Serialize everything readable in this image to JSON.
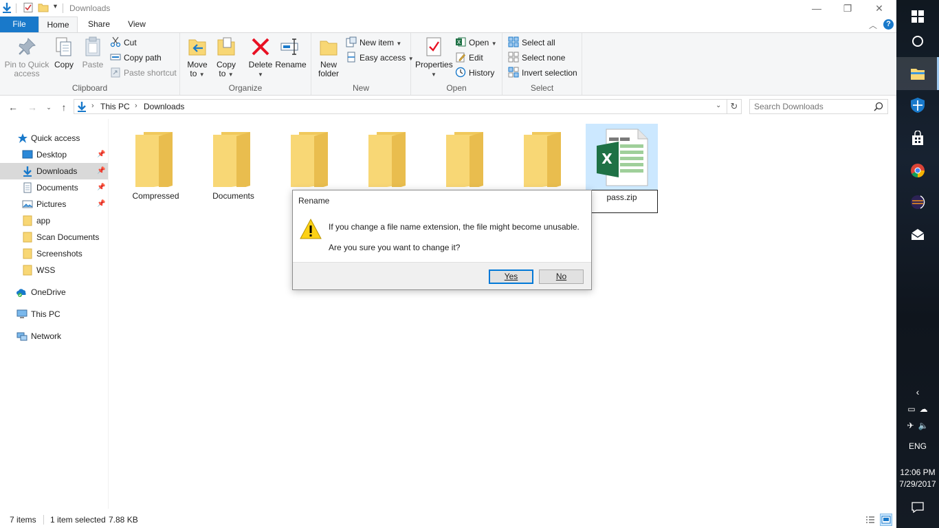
{
  "window": {
    "title": "Downloads",
    "controls": {
      "minimize": "—",
      "maximize": "❐",
      "close": "✕"
    }
  },
  "tabs": {
    "file": "File",
    "home": "Home",
    "share": "Share",
    "view": "View"
  },
  "ribbon": {
    "clipboard": {
      "label": "Clipboard",
      "pin_line1": "Pin to Quick",
      "pin_line2": "access",
      "copy": "Copy",
      "paste": "Paste",
      "cut": "Cut",
      "copy_path": "Copy path",
      "paste_shortcut": "Paste shortcut"
    },
    "organize": {
      "label": "Organize",
      "move_to_1": "Move",
      "move_to_2": "to",
      "copy_to_1": "Copy",
      "copy_to_2": "to",
      "delete": "Delete",
      "rename": "Rename"
    },
    "new": {
      "label": "New",
      "new_folder_1": "New",
      "new_folder_2": "folder",
      "new_item": "New item",
      "easy_access": "Easy access"
    },
    "open": {
      "label": "Open",
      "properties": "Properties",
      "open": "Open",
      "edit": "Edit",
      "history": "History"
    },
    "select": {
      "label": "Select",
      "select_all": "Select all",
      "select_none": "Select none",
      "invert_selection": "Invert selection"
    }
  },
  "address": {
    "crumbs": [
      "This PC",
      "Downloads"
    ],
    "search_placeholder": "Search Downloads"
  },
  "nav": {
    "quick_access": "Quick access",
    "items": [
      {
        "label": "Desktop",
        "pinned": true
      },
      {
        "label": "Downloads",
        "pinned": true
      },
      {
        "label": "Documents",
        "pinned": true
      },
      {
        "label": "Pictures",
        "pinned": true
      },
      {
        "label": "app",
        "pinned": false
      },
      {
        "label": "Scan Documents",
        "pinned": false
      },
      {
        "label": "Screenshots",
        "pinned": false
      },
      {
        "label": "WSS",
        "pinned": false
      }
    ],
    "onedrive": "OneDrive",
    "this_pc": "This PC",
    "network": "Network"
  },
  "files": [
    {
      "name": "Compressed",
      "type": "folder"
    },
    {
      "name": "Documents",
      "type": "folder"
    },
    {
      "name": "",
      "type": "folder"
    },
    {
      "name": "",
      "type": "folder"
    },
    {
      "name": "",
      "type": "folder"
    },
    {
      "name": "",
      "type": "folder"
    },
    {
      "name": "pass.zip",
      "type": "excel",
      "selected": true,
      "renaming": true
    }
  ],
  "status": {
    "items": "7 items",
    "selected": "1 item selected",
    "size": "7.88 KB"
  },
  "dialog": {
    "title": "Rename",
    "message1": "If you change a file name extension, the file might become unusable.",
    "message2": "Are you sure you want to change it?",
    "yes": "Yes",
    "no": "No"
  },
  "tray": {
    "language": "ENG",
    "time": "12:06 PM",
    "date": "7/29/2017"
  },
  "colors": {
    "accent": "#1979ca",
    "folder": "#f8d775",
    "excel": "#1e7145",
    "selection": "#cce8ff"
  }
}
